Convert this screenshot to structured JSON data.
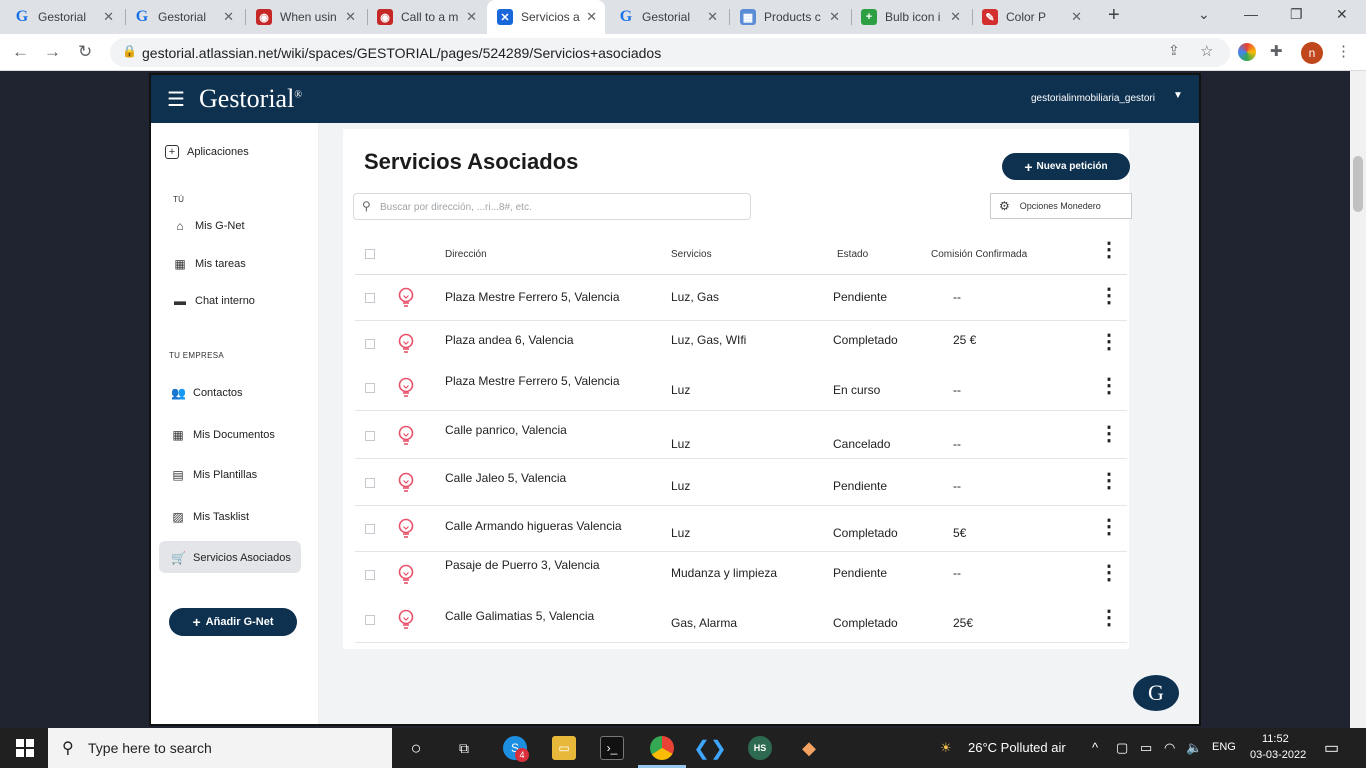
{
  "browser": {
    "tabs": [
      {
        "title": "Gestorial",
        "favicon": "G",
        "color": "#1a73e8"
      },
      {
        "title": "Gestorial",
        "favicon": "G",
        "color": "#1a73e8"
      },
      {
        "title": "When usin",
        "favicon": "ghost",
        "color": "#c62828"
      },
      {
        "title": "Call to a m",
        "favicon": "ghost",
        "color": "#c62828"
      },
      {
        "title": "Servicios a",
        "favicon": "X",
        "color": "#1868db"
      },
      {
        "title": "Gestorial",
        "favicon": "G",
        "color": "#1a73e8"
      },
      {
        "title": "Products c",
        "favicon": "bulb",
        "color": "#5b8dd6"
      },
      {
        "title": "Bulb icon i",
        "favicon": "+",
        "color": "#2ea043"
      },
      {
        "title": "Color P",
        "favicon": "pen",
        "color": "#d32f2f"
      }
    ],
    "active_tab": 4,
    "url": "gestorial.atlassian.net/wiki/spaces/GESTORIAL/pages/524289/Servicios+asociados",
    "profile_initial": "n"
  },
  "app": {
    "logo": "Gestorial",
    "logo_mark": "®",
    "user": "gestorialinmobiliaria_gestori"
  },
  "sidebar": {
    "top_item": "Aplicaciones",
    "section_tu": "TÚ",
    "tu_items": [
      "Mis G-Net",
      "Mis tareas",
      "Chat interno"
    ],
    "section_empresa": "TU EMPRESA",
    "empresa_items": [
      "Contactos",
      "Mis Documentos",
      "Mis Plantillas",
      "Mis Tasklist",
      "Servicios Asociados"
    ],
    "add_button": "Añadir G-Net"
  },
  "main": {
    "title": "Servicios Asociados",
    "search_placeholder": "Buscar por dirección, ...ri...8#, etc.",
    "new_button": "Nueva petición",
    "options_button": "Opciones Monedero",
    "columns": {
      "direccion": "Dirección",
      "servicios": "Servicios",
      "estado": "Estado",
      "comision": "Comisión Confirmada"
    },
    "rows": [
      {
        "direccion": "Plaza Mestre Ferrero 5, Valencia",
        "servicios": "Luz, Gas",
        "estado": "Pendiente",
        "comision": "--"
      },
      {
        "direccion": "Plaza andea 6, Valencia",
        "servicios": "Luz, Gas, WIfi",
        "estado": "Completado",
        "comision": "25 €"
      },
      {
        "direccion": "Plaza Mestre Ferrero 5, Valencia",
        "servicios": "Luz",
        "estado": "En curso",
        "comision": "--"
      },
      {
        "direccion": "Calle panrico, Valencia",
        "servicios": "Luz",
        "estado": "Cancelado",
        "comision": "--"
      },
      {
        "direccion": "Calle  Jaleo 5, Valencia",
        "servicios": "Luz",
        "estado": "Pendiente",
        "comision": "--"
      },
      {
        "direccion": "Calle Armando higueras Valencia",
        "servicios": "Luz",
        "estado": "Completado",
        "comision": "5€"
      },
      {
        "direccion": "Pasaje de Puerro 3, Valencia",
        "servicios": "Mudanza y limpieza",
        "estado": "Pendiente",
        "comision": "--"
      },
      {
        "direccion": "Calle Galimatias 5, Valencia",
        "servicios": "Gas, Alarma",
        "estado": "Completado",
        "comision": "25€"
      }
    ],
    "chat_bubble": "G"
  },
  "taskbar": {
    "search_placeholder": "Type here to search",
    "badge": "4",
    "hs_label": "HS",
    "weather": "26°C  Polluted air",
    "lang": "ENG",
    "time": "11:52",
    "date": "03-03-2022"
  }
}
